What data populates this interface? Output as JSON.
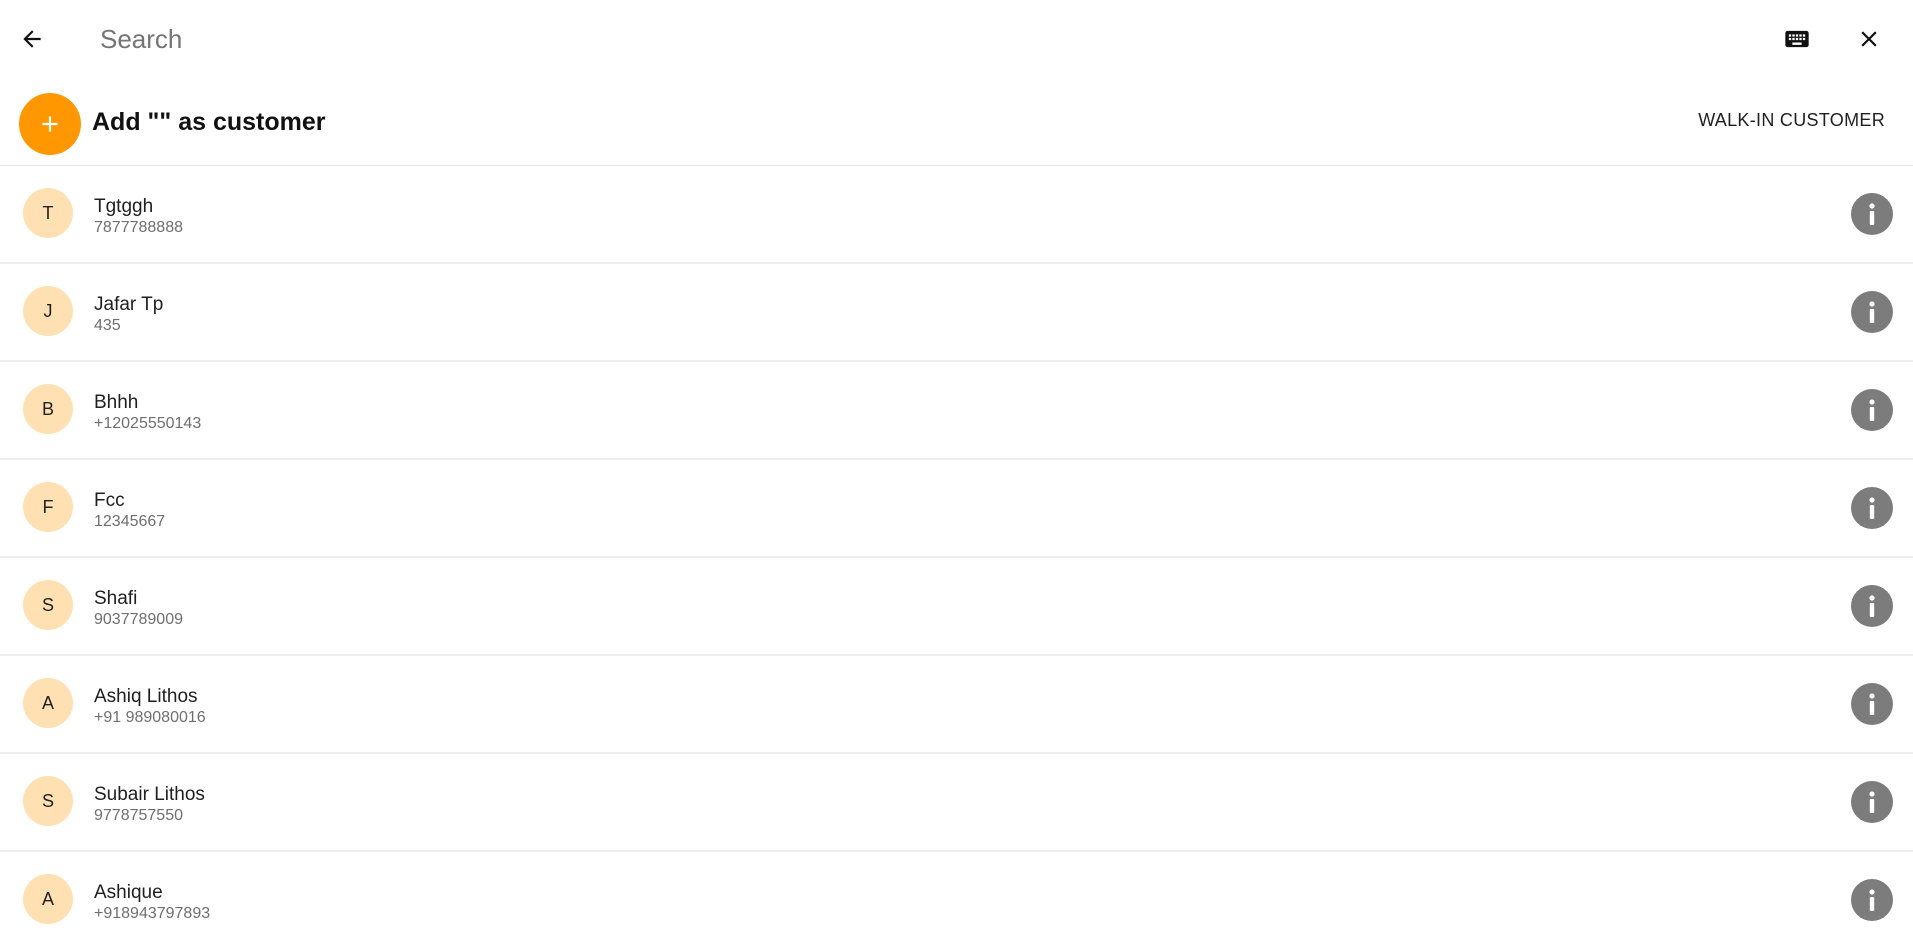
{
  "search": {
    "placeholder": "Search",
    "value": ""
  },
  "icons": {
    "back": "arrow-left-icon",
    "keyboard": "keyboard-icon",
    "close": "close-icon",
    "add": "plus-icon",
    "info": "info-icon"
  },
  "colors": {
    "accent": "#ff9800",
    "avatar_bg": "#ffe0b2",
    "info_icon": "#7c7c7c"
  },
  "add_customer": {
    "label": "Add \"\" as customer"
  },
  "walk_in": {
    "label": "WALK-IN CUSTOMER"
  },
  "customers": [
    {
      "initial": "T",
      "name": "Tgtggh",
      "phone": "7877788888"
    },
    {
      "initial": "J",
      "name": "Jafar Tp",
      "phone": "435"
    },
    {
      "initial": "B",
      "name": "Bhhh",
      "phone": "+12025550143"
    },
    {
      "initial": "F",
      "name": "Fcc",
      "phone": "12345667"
    },
    {
      "initial": "S",
      "name": "Shafi",
      "phone": "9037789009"
    },
    {
      "initial": "A",
      "name": "Ashiq Lithos",
      "phone": "+91 989080016"
    },
    {
      "initial": "S",
      "name": "Subair Lithos",
      "phone": "9778757550"
    },
    {
      "initial": "A",
      "name": "Ashique",
      "phone": "+918943797893"
    }
  ]
}
